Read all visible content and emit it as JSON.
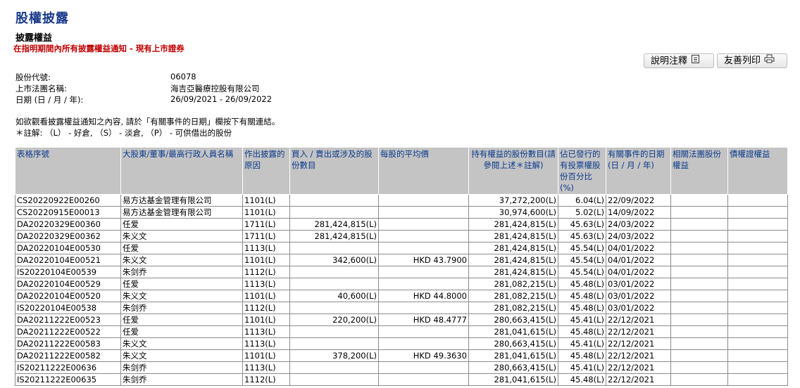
{
  "page": {
    "title": "股權披露",
    "subtitle": "披露權益",
    "notice": "在指明期間內所有披露權益通知 - 現有上市證券"
  },
  "toolbar": {
    "notes_label": "說明注釋",
    "print_label": "友善列印"
  },
  "info": {
    "stock_code_label": "股份代號:",
    "stock_code": "06078",
    "company_label": "上市法團名稱:",
    "company": "海吉亞醫療控股有限公司",
    "date_label": "日期 (日 / 月 / 年):",
    "date_range": "26/09/2021 - 26/09/2022"
  },
  "hint": "如欲觀看披露權益通知之內容, 請於「有關事件的日期」欄按下有關連結。",
  "legend": "＊註解: （L） - 好倉, （S） - 淡倉, （P） - 可供借出的股份",
  "table": {
    "headers": [
      "表格序號",
      "大股東/董事/最高行政人員名稱",
      "作出披露的原因",
      "買入 / 賣出或涉及的股份數目",
      "每股的平均價",
      "持有權益的股份數目(請參閱上述＊註解)",
      "佔已發行的有投票權股份百分比(%)",
      "有關事件的日期(日 / 月 / 年)",
      "相關法團股份權益",
      "債權證權益"
    ],
    "rows": [
      [
        "CS20220922E00260",
        "易方达基金管理有限公司",
        "1101(L)",
        "",
        "",
        "37,272,200(L)",
        "6.04(L)",
        "22/09/2022",
        "",
        ""
      ],
      [
        "CS20220915E00013",
        "易方达基金管理有限公司",
        "1101(L)",
        "",
        "",
        "30,974,600(L)",
        "5.02(L)",
        "14/09/2022",
        "",
        ""
      ],
      [
        "DA20220329E00360",
        "任爱",
        "1711(L)",
        "281,424,815(L)",
        "",
        "281,424,815(L)",
        "45.63(L)",
        "24/03/2022",
        "",
        ""
      ],
      [
        "DA20220329E00362",
        "朱义文",
        "1711(L)",
        "281,424,815(L)",
        "",
        "281,424,815(L)",
        "45.63(L)",
        "24/03/2022",
        "",
        ""
      ],
      [
        "DA20220104E00530",
        "任爱",
        "1113(L)",
        "",
        "",
        "281,424,815(L)",
        "45.54(L)",
        "04/01/2022",
        "",
        ""
      ],
      [
        "DA20220104E00521",
        "朱义文",
        "1101(L)",
        "342,600(L)",
        "HKD 43.7900",
        "281,424,815(L)",
        "45.54(L)",
        "04/01/2022",
        "",
        ""
      ],
      [
        "IS20220104E00539",
        "朱剑乔",
        "1112(L)",
        "",
        "",
        "281,424,815(L)",
        "45.54(L)",
        "04/01/2022",
        "",
        ""
      ],
      [
        "DA20220104E00529",
        "任爱",
        "1113(L)",
        "",
        "",
        "281,082,215(L)",
        "45.48(L)",
        "03/01/2022",
        "",
        ""
      ],
      [
        "DA20220104E00520",
        "朱义文",
        "1101(L)",
        "40,600(L)",
        "HKD 44.8000",
        "281,082,215(L)",
        "45.48(L)",
        "03/01/2022",
        "",
        ""
      ],
      [
        "IS20220104E00538",
        "朱剑乔",
        "1112(L)",
        "",
        "",
        "281,082,215(L)",
        "45.48(L)",
        "03/01/2022",
        "",
        ""
      ],
      [
        "DA20211222E00523",
        "任爱",
        "1101(L)",
        "220,200(L)",
        "HKD 48.4777",
        "280,663,415(L)",
        "45.41(L)",
        "22/12/2021",
        "",
        ""
      ],
      [
        "DA20211222E00522",
        "任爱",
        "1113(L)",
        "",
        "",
        "281,041,615(L)",
        "45.48(L)",
        "22/12/2021",
        "",
        ""
      ],
      [
        "DA20211222E00583",
        "朱义文",
        "1113(L)",
        "",
        "",
        "280,663,415(L)",
        "45.41(L)",
        "22/12/2021",
        "",
        ""
      ],
      [
        "DA20211222E00582",
        "朱义文",
        "1101(L)",
        "378,200(L)",
        "HKD 49.3630",
        "281,041,615(L)",
        "45.48(L)",
        "22/12/2021",
        "",
        ""
      ],
      [
        "IS20211222E00636",
        "朱剑乔",
        "1113(L)",
        "",
        "",
        "280,663,415(L)",
        "45.41(L)",
        "22/12/2021",
        "",
        ""
      ],
      [
        "IS20211222E00635",
        "朱剑乔",
        "1112(L)",
        "",
        "",
        "281,041,615(L)",
        "45.48(L)",
        "22/12/2021",
        "",
        ""
      ]
    ]
  },
  "icons": {
    "notes": "document-icon",
    "print": "printer-icon"
  },
  "colors": {
    "title": "#1a3a8a",
    "notice": "#c00000",
    "header_bg": "#c4c4c4",
    "header_text": "#0a3a8c"
  }
}
